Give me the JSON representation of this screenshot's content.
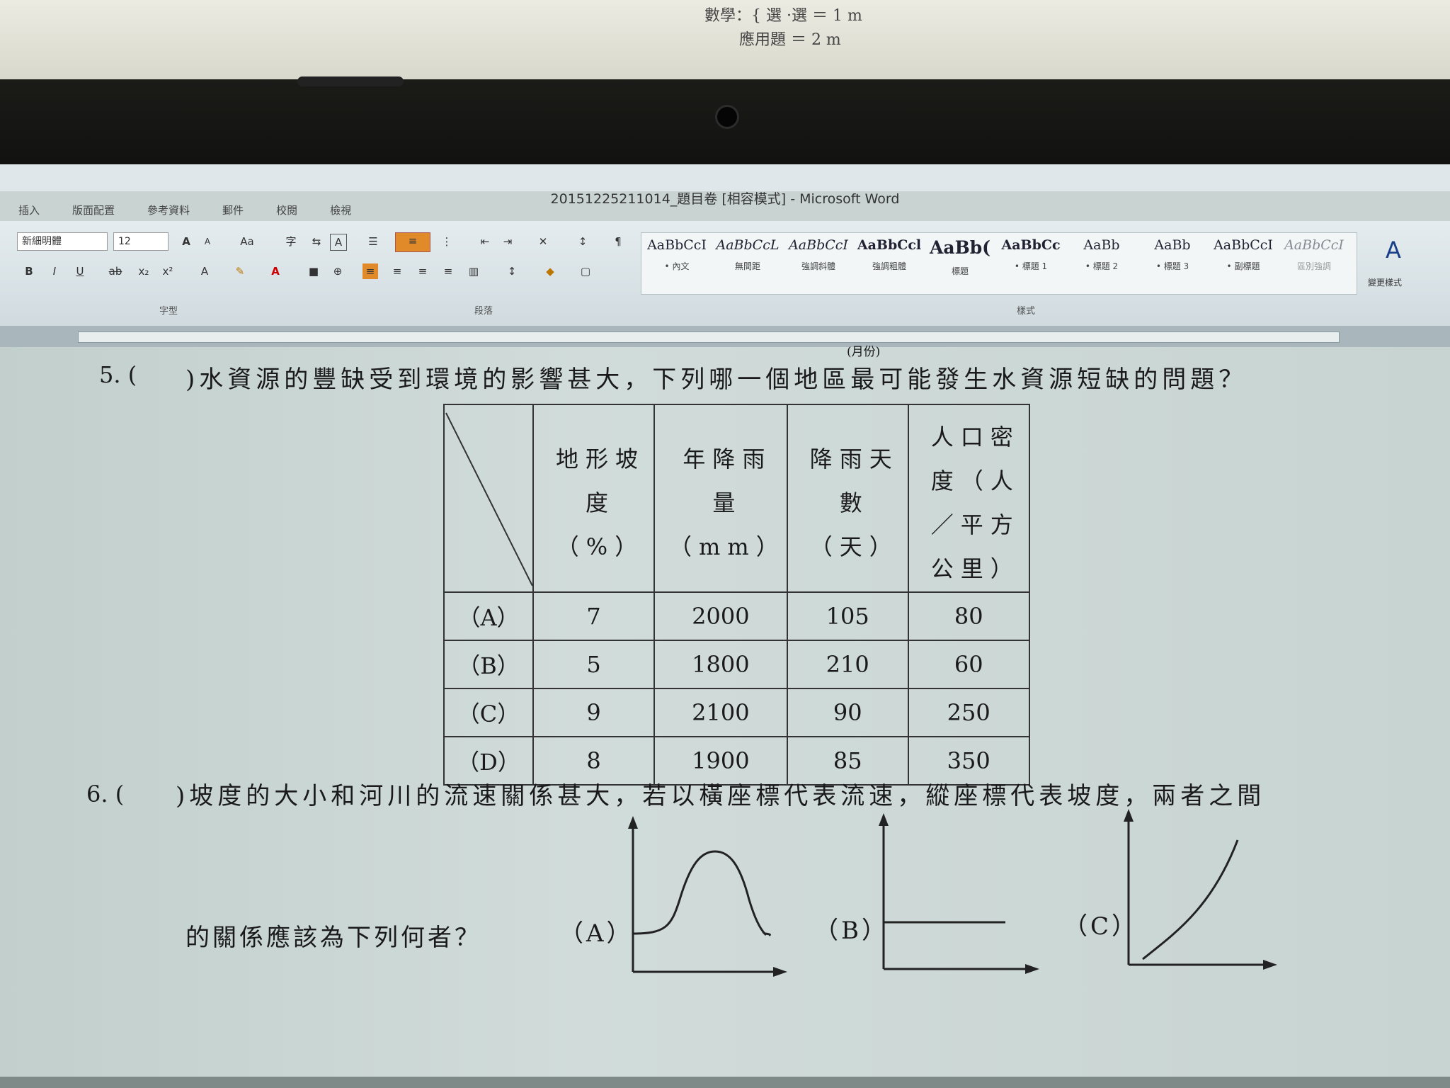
{
  "note": {
    "subject": "數學",
    "lines": [
      "選 ·選 ＝ 1 m",
      "應用題 ＝ 2 m"
    ]
  },
  "window": {
    "title": "20151225211014_題目卷 [相容模式] - Microsoft Word"
  },
  "ribbon": {
    "tabs": [
      "插入",
      "版面配置",
      "參考資料",
      "郵件",
      "校閱",
      "檢視"
    ],
    "font_name": "新細明體",
    "font_size": "12",
    "groups": [
      "字型",
      "段落",
      "樣式"
    ],
    "styles": [
      {
        "sample": "AaBbCcI",
        "name": "• 內文"
      },
      {
        "sample": "AaBbCcL",
        "name": "無間距"
      },
      {
        "sample": "AaBbCcI",
        "name": "強調斜體"
      },
      {
        "sample": "AaBbCcl",
        "name": "強調粗體"
      },
      {
        "sample": "AaBb(",
        "name": "標題"
      },
      {
        "sample": "AaBbCc",
        "name": "• 標題 1"
      },
      {
        "sample": "AaBb",
        "name": "• 標題 2"
      },
      {
        "sample": "AaBb",
        "name": "• 標題 3"
      },
      {
        "sample": "AaBbCcI",
        "name": "• 副標題"
      },
      {
        "sample": "AaBbCcI",
        "name": "區別強調"
      }
    ],
    "change_styles": "變更樣式"
  },
  "ruler_mark": "(月份)",
  "q5": {
    "number": "5. (",
    "text": ")水資源的豐缺受到環境的影響甚大，下列哪一個地區最可能發生水資源短缺的問題？",
    "headers": [
      "地形坡度（%）",
      "年降雨量（mm）",
      "降雨天數（天）",
      "人口密度（人／平方公里）"
    ],
    "header_lines": [
      [
        "地形坡",
        "度",
        "（%）"
      ],
      [
        "年降雨",
        "量",
        "（mm）"
      ],
      [
        "降雨天",
        "數",
        "（天）"
      ],
      [
        "人口密",
        "度（人",
        "／平方",
        "公里）"
      ]
    ],
    "rows": [
      {
        "label": "（A）",
        "cells": [
          "7",
          "2000",
          "105",
          "80"
        ]
      },
      {
        "label": "（B）",
        "cells": [
          "5",
          "1800",
          "210",
          "60"
        ]
      },
      {
        "label": "（C）",
        "cells": [
          "9",
          "2100",
          "90",
          "250"
        ]
      },
      {
        "label": "（D）",
        "cells": [
          "8",
          "1900",
          "85",
          "350"
        ]
      }
    ]
  },
  "q6": {
    "number": "6. (",
    "text": ")坡度的大小和河川的流速關係甚大，若以橫座標代表流速，縱座標代表坡度，兩者之間",
    "text2": "的關係應該為下列何者？",
    "options": [
      "（A）",
      "（B）",
      "（C）"
    ]
  }
}
